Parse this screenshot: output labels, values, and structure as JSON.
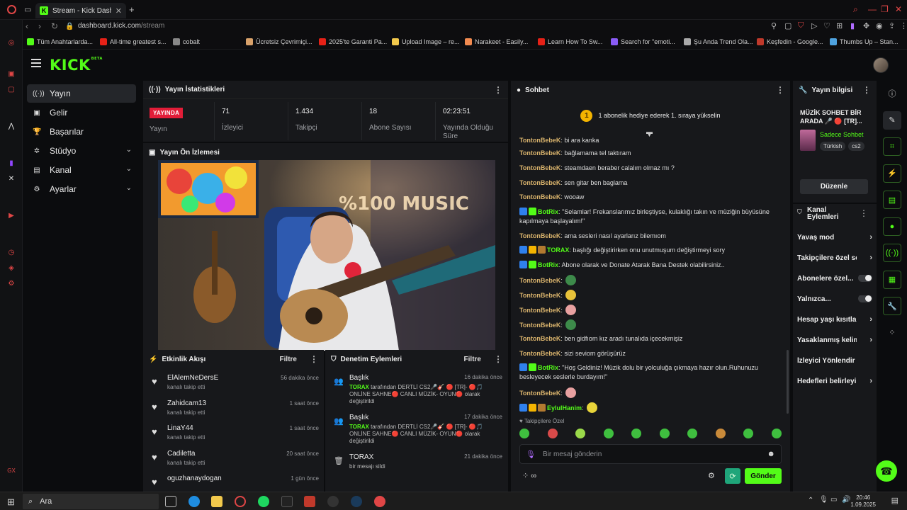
{
  "browser": {
    "tab_title": "Stream - Kick Dashboard",
    "url_domain": "dashboard.kick.com",
    "url_path": "/stream",
    "bookmarks": [
      {
        "label": "Tüm Anahtarlarda...",
        "color": "#53fc18"
      },
      {
        "label": "All-time greatest s...",
        "color": "#e62117"
      },
      {
        "label": "cobalt",
        "color": "#888888"
      },
      {
        "label": "Ücretsiz Çevrimiçi...",
        "color": "#d9a26b"
      },
      {
        "label": "2025'te Garanti Pa...",
        "color": "#e62117"
      },
      {
        "label": "Upload Image – re...",
        "color": "#f2c94c"
      },
      {
        "label": "Narakeet - Easily...",
        "color": "#f28b50"
      },
      {
        "label": "Learn How To Sw...",
        "color": "#e62117"
      },
      {
        "label": "Search for \"emoti...",
        "color": "#8a5cf5"
      },
      {
        "label": "Şu Anda Trend Ola...",
        "color": "#aaaaaa"
      },
      {
        "label": "Keşfedin - Google...",
        "color": "#c0392b"
      },
      {
        "label": "Thumbs Up – Stan...",
        "color": "#4fa3e0"
      }
    ]
  },
  "kick": {
    "logo": "KICK",
    "logo_sup": "BETA"
  },
  "nav": [
    {
      "label": "Yayın",
      "icon": "broadcast-icon",
      "glyph": "((·))",
      "active": true,
      "chev": false
    },
    {
      "label": "Gelir",
      "icon": "money-icon",
      "glyph": "▣",
      "active": false,
      "chev": false
    },
    {
      "label": "Başarılar",
      "icon": "trophy-icon",
      "glyph": "🏆",
      "active": false,
      "chev": false
    },
    {
      "label": "Stüdyo",
      "icon": "studio-icon",
      "glyph": "✲",
      "active": false,
      "chev": true
    },
    {
      "label": "Kanal",
      "icon": "channel-icon",
      "glyph": "▤",
      "active": false,
      "chev": true
    },
    {
      "label": "Ayarlar",
      "icon": "gear-icon",
      "glyph": "⚙",
      "active": false,
      "chev": true
    }
  ],
  "stats": {
    "title": "Yayın İstatistikleri",
    "live_badge": "YAYINDA",
    "live_label": "Yayın",
    "cells": [
      {
        "value": "71",
        "label": "İzleyici"
      },
      {
        "value": "1.434",
        "label": "Takipçi"
      },
      {
        "value": "18",
        "label": "Abone Sayısı"
      },
      {
        "value": "02:23:51",
        "label": "Yayında Olduğu Süre"
      }
    ]
  },
  "preview": {
    "title": "Yayın Ön İzlemesi"
  },
  "activity": {
    "title": "Etkinlik Akışı",
    "filter": "Filtre",
    "items": [
      {
        "name": "ElAlemNeDersE",
        "sub": "kanalı takip etti",
        "time": "56 dakika önce"
      },
      {
        "name": "Zahidcam13",
        "sub": "kanalı takip etti",
        "time": "1 saat önce"
      },
      {
        "name": "LinaY44",
        "sub": "kanalı takip etti",
        "time": "1 saat önce"
      },
      {
        "name": "Cadiletta",
        "sub": "kanalı takip etti",
        "time": "20 saat önce"
      },
      {
        "name": "oguzhanaydogan",
        "sub": "",
        "time": "1 gün önce"
      }
    ]
  },
  "moderation": {
    "title": "Denetim Eylemleri",
    "filter": "Filtre",
    "items": [
      {
        "title": "Başlık",
        "time": "16 dakika önce",
        "actor": "TORAX",
        "desc_a": " tarafından DERTLİ CS2🎤🎸 🔴 [TR]- 🔴🎵 ONLİNE SAHNE🔴 CANLI MÜZİK- OYUN🔴 olarak değiştirildi",
        "icon": "people-icon"
      },
      {
        "title": "Başlık",
        "time": "17 dakika önce",
        "actor": "TORAX",
        "desc_a": " tarafından DERTLİ CS2🎤🎸 🔴 [TR]- 🔴🎵 ONLİNE SAHNE🔴 CANLI MÜZİK- OYUN🔴 olarak değiştirildi",
        "icon": "people-icon"
      },
      {
        "title": "TORAX",
        "time": "21 dakika önce",
        "actor": "",
        "desc_a": "bir mesajı sildi",
        "icon": "trash-icon"
      }
    ]
  },
  "chat": {
    "title": "Sohbet",
    "gift_count": "1",
    "gift_text": "1 abonelik hediye ederek 1. sıraya yükselin",
    "messages": [
      {
        "user": "TontonBebeK",
        "color": "#d9b36c",
        "text": "bi ara kanka",
        "badges": []
      },
      {
        "user": "TontonBebeK",
        "color": "#d9b36c",
        "text": "bağlamama tel taktıram",
        "badges": []
      },
      {
        "user": "TontonBebeK",
        "color": "#d9b36c",
        "text": "steamdaen beraber calalım olmaz mı ?",
        "badges": []
      },
      {
        "user": "TontonBebeK",
        "color": "#d9b36c",
        "text": "sen gitar ben baglama",
        "badges": []
      },
      {
        "user": "TontonBebeK",
        "color": "#d9b36c",
        "text": "wooaw",
        "badges": []
      },
      {
        "user": "BotRix",
        "color": "#53fc18",
        "text": "\"Selamlar! Frekanslarımız birleştiyse, kulaklığı takın ve müziğin büyüsüne kapılmaya başlayalım!\"",
        "badges": [
          "#2f80ed",
          "#53fc18"
        ]
      },
      {
        "user": "TontonBebeK",
        "color": "#d9b36c",
        "text": "ama sesleri nasıl ayarlarız bilemıom",
        "badges": []
      },
      {
        "user": "TORAX",
        "color": "#53fc18",
        "text": "başlığı değiştirirken onu unutmuşum değiştirmeyi sory",
        "badges": [
          "#2f80ed",
          "#f4b400",
          "#b27a30"
        ]
      },
      {
        "user": "BotRix",
        "color": "#53fc18",
        "text": "Abone olarak ve Donate Atarak Bana Destek olabilirsiniz..",
        "badges": [
          "#2f80ed",
          "#53fc18"
        ]
      },
      {
        "user": "TontonBebeK",
        "color": "#d9b36c",
        "text": "",
        "emote": "#3d8a4a",
        "badges": []
      },
      {
        "user": "TontonBebeK",
        "color": "#d9b36c",
        "text": "",
        "emote": "#e8c23a",
        "badges": []
      },
      {
        "user": "TontonBebeK",
        "color": "#d9b36c",
        "text": "",
        "emote": "#e8a0a0",
        "badges": []
      },
      {
        "user": "TontonBebeK",
        "color": "#d9b36c",
        "text": "",
        "emote": "#3d8a4a",
        "badges": []
      },
      {
        "user": "TontonBebeK",
        "color": "#d9b36c",
        "text": "ben gidfıom kız aradı tunalıda içecekmişiz",
        "badges": []
      },
      {
        "user": "TontonBebeK",
        "color": "#d9b36c",
        "text": "sizi seviom görüşürüz",
        "badges": []
      },
      {
        "user": "BotRix",
        "color": "#53fc18",
        "text": "\"Hoş Geldiniz! Müzik dolu bir yolculuğa çıkmaya hazır olun.Ruhunuzu besleyecek seslerle burdayım!\"",
        "badges": [
          "#2f80ed",
          "#53fc18"
        ]
      },
      {
        "user": "TontonBebeK",
        "color": "#d9b36c",
        "text": "",
        "emote": "#e8a0a0",
        "badges": []
      },
      {
        "user": "EylulHanim",
        "color": "#53fc18",
        "text": "",
        "emote": "#e8d43a",
        "badges": [
          "#2f80ed",
          "#f4b400",
          "#b27a30"
        ]
      }
    ],
    "followers_only": "Takipçilere Özel",
    "emotes": [
      "#3fbf3f",
      "#d94a4a",
      "#9ad94a",
      "#3fbf3f",
      "#3fbf3f",
      "#3fbf3f",
      "#3fbf3f",
      "#c98a3a",
      "#3fbf3f",
      "#3fbf3f"
    ],
    "input_placeholder": "Bir mesaj gönderin",
    "send_label": "Gönder",
    "points_symbol": "∞"
  },
  "info": {
    "title": "Yayın bilgisi",
    "stream_title": "MÜZİK SOHBET BİR ARADA 🎤 🔴 [TR]...",
    "category": "Sadece Sohbet",
    "tags": [
      "Türkish",
      "cs2"
    ],
    "edit_label": "Düzenle"
  },
  "actions": {
    "title": "Kanal Eylemleri",
    "items": [
      {
        "label": "Yavaş mod",
        "kind": "arrow"
      },
      {
        "label": "Takipçilere özel sohbet",
        "kind": "arrow"
      },
      {
        "label": "Abonelere özel...",
        "kind": "toggle"
      },
      {
        "label": "Yalnızca...",
        "kind": "toggle"
      },
      {
        "label": "Hesap yaşı kısıtlaması",
        "kind": "arrow"
      },
      {
        "label": "Yasaklanmış kelimeler",
        "kind": "arrow"
      },
      {
        "label": "İzleyici Yönlendir",
        "kind": "none"
      },
      {
        "label": "Hedefleri belirleyin",
        "kind": "arrow"
      }
    ]
  },
  "right_icons": [
    "info-icon",
    "pencil-icon",
    "scan-icon",
    "bolt-icon",
    "clipboard-icon",
    "chat-icon",
    "broadcast-icon",
    "layout-icon",
    "wrench-icon",
    "apps-icon"
  ],
  "taskbar": {
    "search_label": "Ara",
    "time": "20:46",
    "date": "1.09.2025"
  },
  "colors": {
    "accent": "#53fc18",
    "live": "#e21d38",
    "panel": "#17181b"
  }
}
